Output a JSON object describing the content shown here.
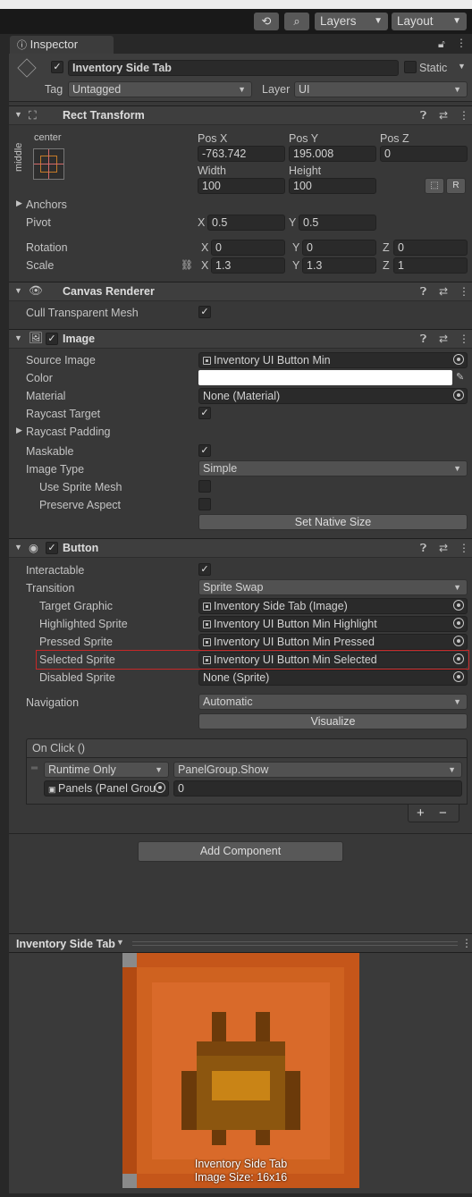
{
  "toolbar": {
    "history_icon": "history-icon",
    "search_icon": "search-icon",
    "layers": "Layers",
    "layout": "Layout"
  },
  "inspector": {
    "tab_label": "Inspector",
    "object_name": "Inventory Side Tab",
    "static_label": "Static",
    "tag_label": "Tag",
    "tag_value": "Untagged",
    "layer_label": "Layer",
    "layer_value": "UI"
  },
  "rect_transform": {
    "title": "Rect Transform",
    "anchor_h": "center",
    "anchor_v": "middle",
    "pos_x_label": "Pos X",
    "pos_y_label": "Pos Y",
    "pos_z_label": "Pos Z",
    "pos_x": "-763.742",
    "pos_y": "195.008",
    "pos_z": "0",
    "width_label": "Width",
    "height_label": "Height",
    "width": "100",
    "height": "100",
    "r_btn": "R",
    "anchors_label": "Anchors",
    "pivot_label": "Pivot",
    "pivot_x": "0.5",
    "pivot_y": "0.5",
    "rotation_label": "Rotation",
    "rot_x": "0",
    "rot_y": "0",
    "rot_z": "0",
    "scale_label": "Scale",
    "scale_x": "1.3",
    "scale_y": "1.3",
    "scale_z": "1",
    "x": "X",
    "y": "Y",
    "z": "Z"
  },
  "canvas_renderer": {
    "title": "Canvas Renderer",
    "cull_label": "Cull Transparent Mesh"
  },
  "image": {
    "title": "Image",
    "source_image_label": "Source Image",
    "source_image": "Inventory UI Button Min",
    "color_label": "Color",
    "material_label": "Material",
    "material": "None (Material)",
    "raycast_target_label": "Raycast Target",
    "raycast_padding_label": "Raycast Padding",
    "maskable_label": "Maskable",
    "image_type_label": "Image Type",
    "image_type": "Simple",
    "use_sprite_mesh_label": "Use Sprite Mesh",
    "preserve_aspect_label": "Preserve Aspect",
    "set_native_size": "Set Native Size"
  },
  "button": {
    "title": "Button",
    "interactable_label": "Interactable",
    "transition_label": "Transition",
    "transition": "Sprite Swap",
    "target_graphic_label": "Target Graphic",
    "target_graphic": "Inventory Side Tab (Image)",
    "highlighted_label": "Highlighted Sprite",
    "highlighted": "Inventory UI Button Min Highlight",
    "pressed_label": "Pressed Sprite",
    "pressed": "Inventory UI Button Min Pressed",
    "selected_label": "Selected Sprite",
    "selected": "Inventory UI Button Min Selected",
    "disabled_label": "Disabled Sprite",
    "disabled": "None (Sprite)",
    "navigation_label": "Navigation",
    "navigation": "Automatic",
    "visualize": "Visualize",
    "onclick_label": "On Click ()",
    "runtime": "Runtime Only",
    "function": "PanelGroup.Show",
    "target_obj": "Panels (Panel Grou",
    "arg": "0",
    "plus": "+",
    "minus": "−"
  },
  "add_component": "Add Component",
  "preview": {
    "title": "Inventory Side Tab",
    "caption_name": "Inventory Side Tab",
    "caption_size": "Image Size: 16x16"
  },
  "colors": {
    "highlight_red": "#c62828",
    "sprite_orange": "#c5561a",
    "sprite_dark": "#6b3a0a"
  }
}
